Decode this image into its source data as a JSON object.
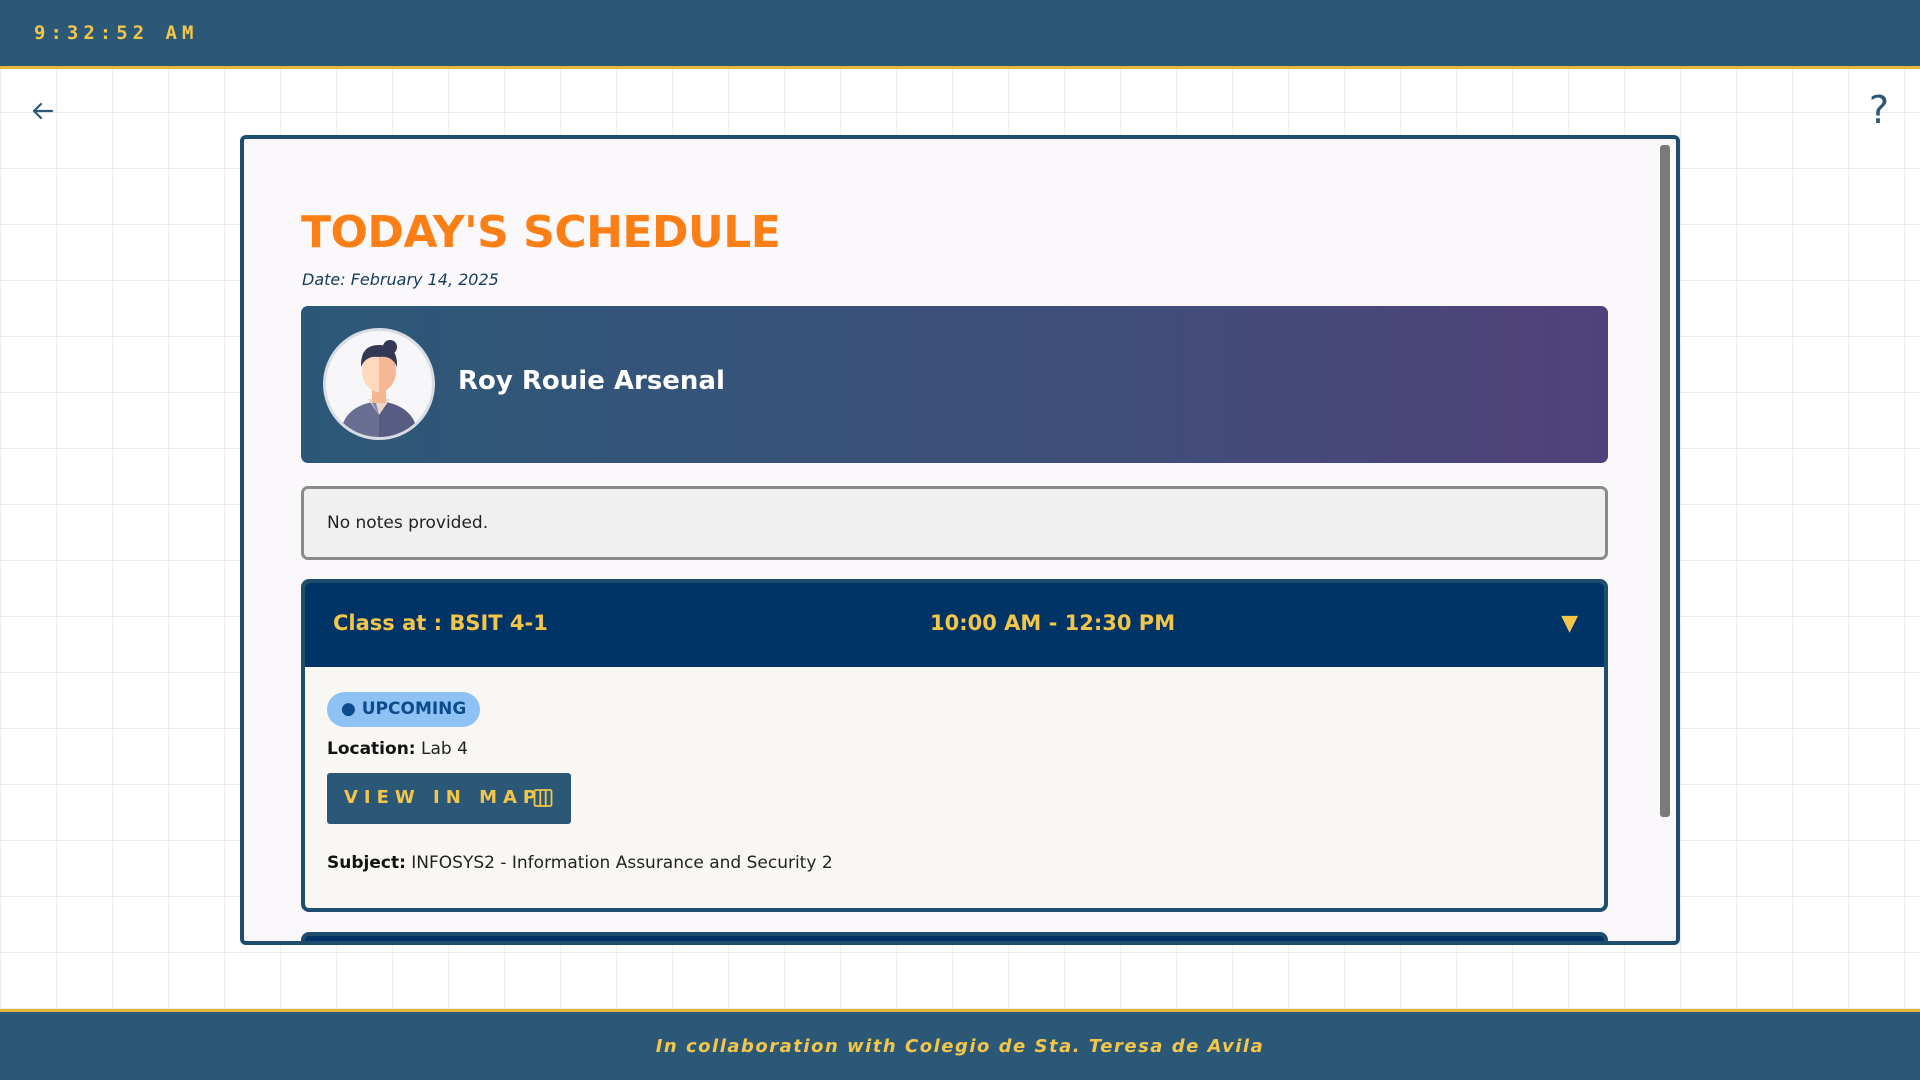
{
  "header": {
    "clock": "9:32:52 AM"
  },
  "nav": {
    "back_icon": "arrow-left-icon",
    "help_label": "?"
  },
  "schedule": {
    "title": "TODAY'S SCHEDULE",
    "date": "Date: February 14, 2025",
    "teacher_name": "Roy Rouie Arsenal",
    "notes": "No notes provided.",
    "classes": [
      {
        "class_label": "Class at : BSIT 4-1",
        "time": "10:00 AM - 12:30 PM",
        "toggle": "▼",
        "status": "● UPCOMING",
        "location_label": "Location:",
        "location_value": "Lab 4",
        "map_button_label": "VIEW IN MAP",
        "map_icon": "map-icon",
        "subject_label": "Subject:",
        "subject_value": "INFOSYS2 - Information Assurance and Security 2"
      }
    ]
  },
  "footer": {
    "text": "In collaboration with Colegio de Sta. Teresa de Avila"
  },
  "colors": {
    "primary": "#2c5878",
    "navy": "#003366",
    "accent": "#f3c64a",
    "title_orange": "#fb7f14",
    "badge_bg": "#8fc2f4"
  }
}
